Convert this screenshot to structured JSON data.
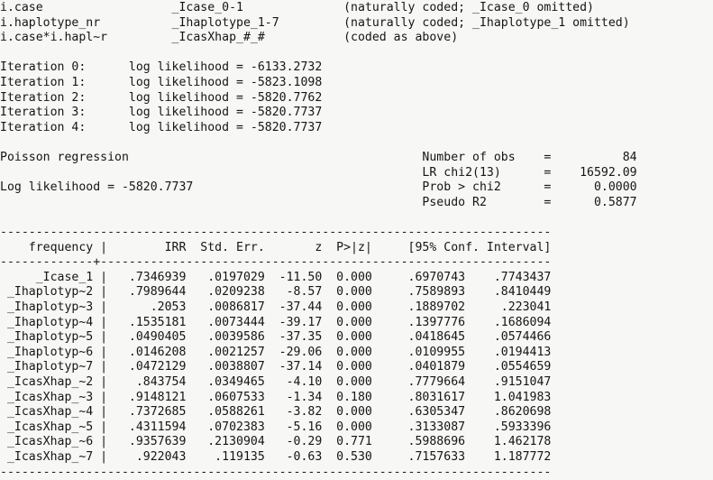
{
  "console": {
    "app": "stata-results-window",
    "background_color": "#f7f7f5",
    "text_color": "#151515",
    "varlist_header": [
      {
        "term": "i.case",
        "generated": "_Icase_0-1",
        "note": "(naturally coded; _Icase_0 omitted)"
      },
      {
        "term": "i.haplotype_nr",
        "generated": "_Ihaplotype_1-7",
        "note": "(naturally coded; _Ihaplotype_1 omitted)"
      },
      {
        "term": "i.case*i.hapl~r",
        "generated": "_IcasXhap_#_#",
        "note": "(coded as above)"
      }
    ],
    "iterations": [
      {
        "label": "Iteration 0:",
        "metric": "log likelihood",
        "eq": "=",
        "value": "-6133.2732"
      },
      {
        "label": "Iteration 1:",
        "metric": "log likelihood",
        "eq": "=",
        "value": "-5823.1098"
      },
      {
        "label": "Iteration 2:",
        "metric": "log likelihood",
        "eq": "=",
        "value": "-5820.7762"
      },
      {
        "label": "Iteration 3:",
        "metric": "log likelihood",
        "eq": "=",
        "value": "-5820.7737"
      },
      {
        "label": "Iteration 4:",
        "metric": "log likelihood",
        "eq": "=",
        "value": "-5820.7737"
      }
    ],
    "model": {
      "title": "Poisson regression",
      "log_likelihood_label": "Log likelihood =",
      "log_likelihood_value": "-5820.7737"
    },
    "fit_stats": [
      {
        "label": "Number of obs",
        "eq": "=",
        "value": "84"
      },
      {
        "label": "LR chi2(13)",
        "eq": "=",
        "value": "16592.09"
      },
      {
        "label": "Prob > chi2",
        "eq": "=",
        "value": "0.0000"
      },
      {
        "label": "Pseudo R2",
        "eq": "=",
        "value": "0.5877"
      }
    ],
    "table": {
      "row_label_header": "frequency",
      "columns": [
        "IRR",
        "Std. Err.",
        "z",
        "P>|z|",
        "[95% Conf. Interval]"
      ],
      "conf_header_text": "[95% Conf. Interval]",
      "separator_top": "-----------------------------------------------------------------------------",
      "separator_mid": "-------------+---------------------------------------------------------------",
      "separator_bottom": "-----------------------------------------------------------------------------",
      "rows": [
        {
          "name": "_Icase_1",
          "irr": ".7346939",
          "se": ".0197029",
          "z": "-11.50",
          "p": "0.000",
          "ci_low": ".6970743",
          "ci_high": ".7743437"
        },
        {
          "name": "_Ihaplotyp~2",
          "irr": ".7989644",
          "se": ".0209238",
          "z": "-8.57",
          "p": "0.000",
          "ci_low": ".7589893",
          "ci_high": ".8410449"
        },
        {
          "name": "_Ihaplotyp~3",
          "irr": ".2053",
          "se": ".0086817",
          "z": "-37.44",
          "p": "0.000",
          "ci_low": ".1889702",
          "ci_high": ".223041"
        },
        {
          "name": "_Ihaplotyp~4",
          "irr": ".1535181",
          "se": ".0073444",
          "z": "-39.17",
          "p": "0.000",
          "ci_low": ".1397776",
          "ci_high": ".1686094"
        },
        {
          "name": "_Ihaplotyp~5",
          "irr": ".0490405",
          "se": ".0039586",
          "z": "-37.35",
          "p": "0.000",
          "ci_low": ".0418645",
          "ci_high": ".0574466"
        },
        {
          "name": "_Ihaplotyp~6",
          "irr": ".0146208",
          "se": ".0021257",
          "z": "-29.06",
          "p": "0.000",
          "ci_low": ".0109955",
          "ci_high": ".0194413"
        },
        {
          "name": "_Ihaplotyp~7",
          "irr": ".0472129",
          "se": ".0038807",
          "z": "-37.14",
          "p": "0.000",
          "ci_low": ".0401879",
          "ci_high": ".0554659"
        },
        {
          "name": "_IcasXhap_~2",
          "irr": ".843754",
          "se": ".0349465",
          "z": "-4.10",
          "p": "0.000",
          "ci_low": ".7779664",
          "ci_high": ".9151047"
        },
        {
          "name": "_IcasXhap_~3",
          "irr": ".9148121",
          "se": ".0607533",
          "z": "-1.34",
          "p": "0.180",
          "ci_low": ".8031617",
          "ci_high": "1.041983"
        },
        {
          "name": "_IcasXhap_~4",
          "irr": ".7372685",
          "se": ".0588261",
          "z": "-3.82",
          "p": "0.000",
          "ci_low": ".6305347",
          "ci_high": ".8620698"
        },
        {
          "name": "_IcasXhap_~5",
          "irr": ".4311594",
          "se": ".0702383",
          "z": "-5.16",
          "p": "0.000",
          "ci_low": ".3133087",
          "ci_high": ".5933396"
        },
        {
          "name": "_IcasXhap_~6",
          "irr": ".9357639",
          "se": ".2130904",
          "z": "-0.29",
          "p": "0.771",
          "ci_low": ".5988696",
          "ci_high": "1.462178"
        },
        {
          "name": "_IcasXhap_~7",
          "irr": ".922043",
          "se": ".119135",
          "z": "-0.63",
          "p": "0.530",
          "ci_low": ".7157633",
          "ci_high": "1.187772"
        }
      ]
    }
  }
}
